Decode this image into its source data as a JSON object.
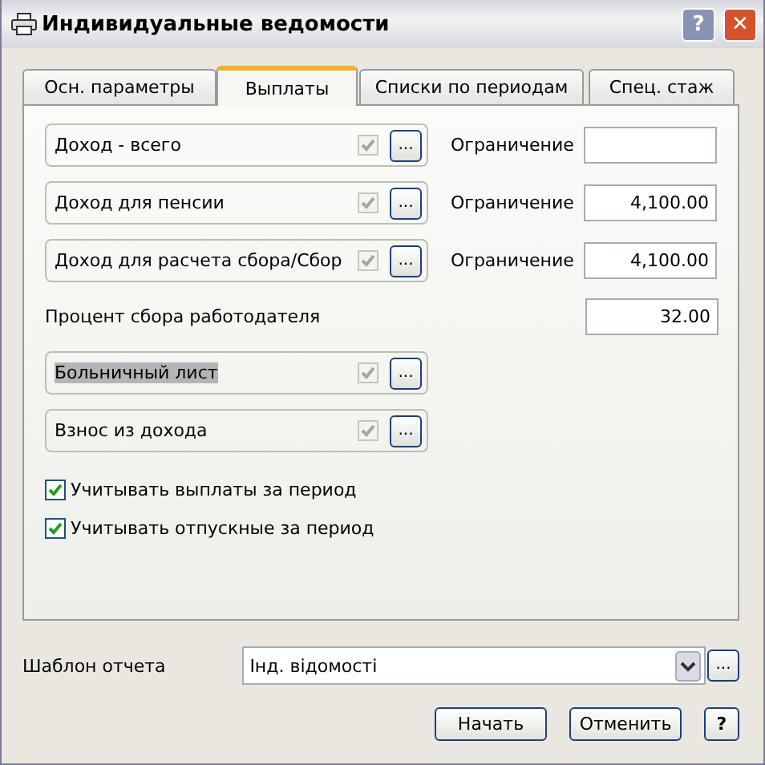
{
  "window": {
    "title": "Индивидуальные ведомости",
    "help": "?",
    "close": "✕"
  },
  "tabs": [
    {
      "label": "Осн. параметры",
      "selected": false
    },
    {
      "label": "Выплаты",
      "selected": true
    },
    {
      "label": "Списки по периодам",
      "selected": false
    },
    {
      "label": "Спец. стаж",
      "selected": false
    }
  ],
  "rows": [
    {
      "kind": "group",
      "label": "Доход - всего",
      "checked": true,
      "selected": false,
      "button": "...",
      "limit_label": "Ограничение",
      "limit_value": ""
    },
    {
      "kind": "group",
      "label": "Доход для пенсии",
      "checked": true,
      "selected": false,
      "button": "...",
      "limit_label": "Ограничение",
      "limit_value": "4,100.00"
    },
    {
      "kind": "group",
      "label": "Доход для расчета сбора/Сбор",
      "checked": true,
      "selected": false,
      "button": "...",
      "limit_label": "Ограничение",
      "limit_value": "4,100.00"
    },
    {
      "kind": "field",
      "label": "Процент сбора работодателя",
      "value": "32.00"
    },
    {
      "kind": "group",
      "label": "Больничный лист",
      "checked": true,
      "selected": true,
      "button": "..."
    },
    {
      "kind": "group",
      "label": "Взнос из дохода",
      "checked": true,
      "selected": false,
      "button": "..."
    },
    {
      "kind": "checkbox",
      "label": "Учитывать выплаты за период",
      "checked": true
    },
    {
      "kind": "checkbox",
      "label": "Учитывать отпускные за период",
      "checked": true
    }
  ],
  "template": {
    "label": "Шаблон отчета",
    "value": "Інд. відомості",
    "button": "..."
  },
  "buttons": [
    {
      "label": "Начать"
    },
    {
      "label": "Отменить"
    },
    {
      "label": "?"
    }
  ]
}
